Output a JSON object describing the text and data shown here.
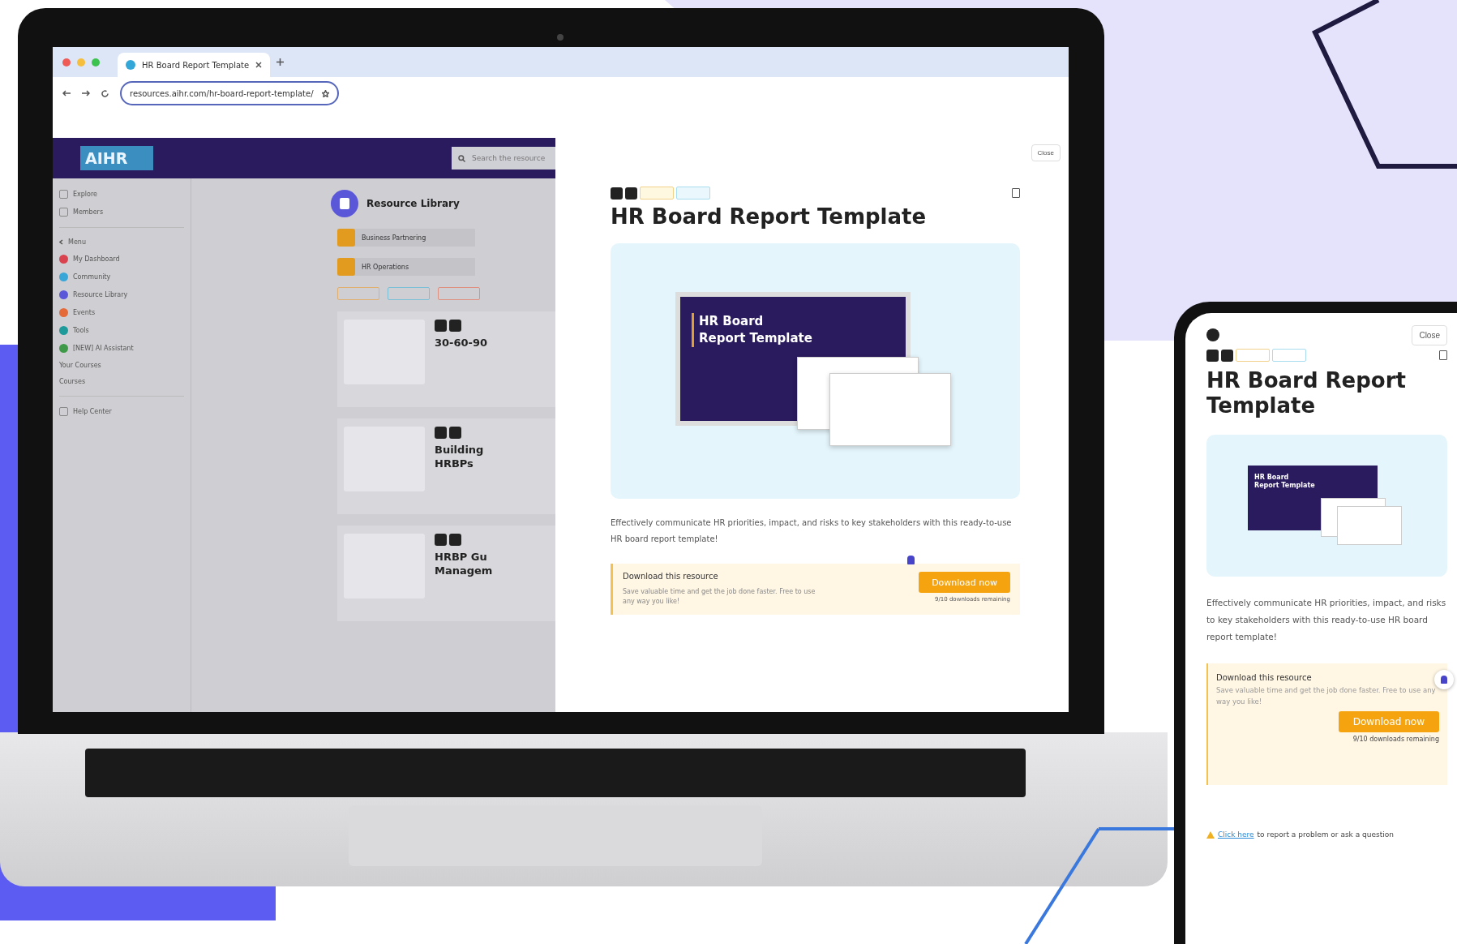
{
  "browser": {
    "tab_title": "HR Board Report Template",
    "url": "resources.aihr.com/hr-board-report-template/"
  },
  "app": {
    "logo": "AIHR",
    "search_placeholder": "Search the resource",
    "sidebar": {
      "top_items": [
        "Explore",
        "Members"
      ],
      "menu_label": "Menu",
      "items": [
        {
          "label": "My Dashboard",
          "color": "#d9434f"
        },
        {
          "label": "Community",
          "color": "#3aa6d8"
        },
        {
          "label": "Resource Library",
          "color": "#5b57d9"
        },
        {
          "label": "Events",
          "color": "#e46a3a"
        },
        {
          "label": "Tools",
          "color": "#1f9a9a"
        },
        {
          "label": "[NEW] AI Assistant",
          "color": "#3e9a48"
        }
      ],
      "sections": [
        "Your Courses",
        "Courses"
      ],
      "bottom_items": [
        "Help Center"
      ]
    },
    "library": {
      "title": "Resource Library",
      "categories": [
        "Business Partnering",
        "HR Operations"
      ],
      "cards": [
        {
          "title_lines": [
            "30-60-90"
          ]
        },
        {
          "title_lines": [
            "Building",
            "HRBPs"
          ]
        },
        {
          "title_lines": [
            "HRBP Gu",
            "Managem"
          ]
        }
      ]
    }
  },
  "detail": {
    "close": "Close",
    "title": "HR Board Report Template",
    "slide_title_lines": [
      "HR Board",
      "Report Template"
    ],
    "description": "Effectively communicate HR priorities, impact, and risks to key stakeholders with this ready-to-use HR board report template!",
    "download": {
      "heading": "Download this resource",
      "body": "Save valuable time and get the job done faster. Free to use any way you like!",
      "button": "Download now",
      "remaining": "9/10 downloads remaining"
    }
  },
  "phone": {
    "close": "Close",
    "title": "HR Board Report Template",
    "slide_title_lines": [
      "HR Board",
      "Report Template"
    ],
    "description": "Effectively communicate HR priorities, impact, and risks to key stakeholders with this ready-to-use HR board report template!",
    "download": {
      "heading": "Download this resource",
      "body": "Save valuable time and get the job done faster. Free to use any way you like!",
      "button": "Download now",
      "remaining": "9/10 downloads remaining"
    },
    "footer_link": "Click here",
    "footer_text": "to report a problem or ask a question"
  }
}
